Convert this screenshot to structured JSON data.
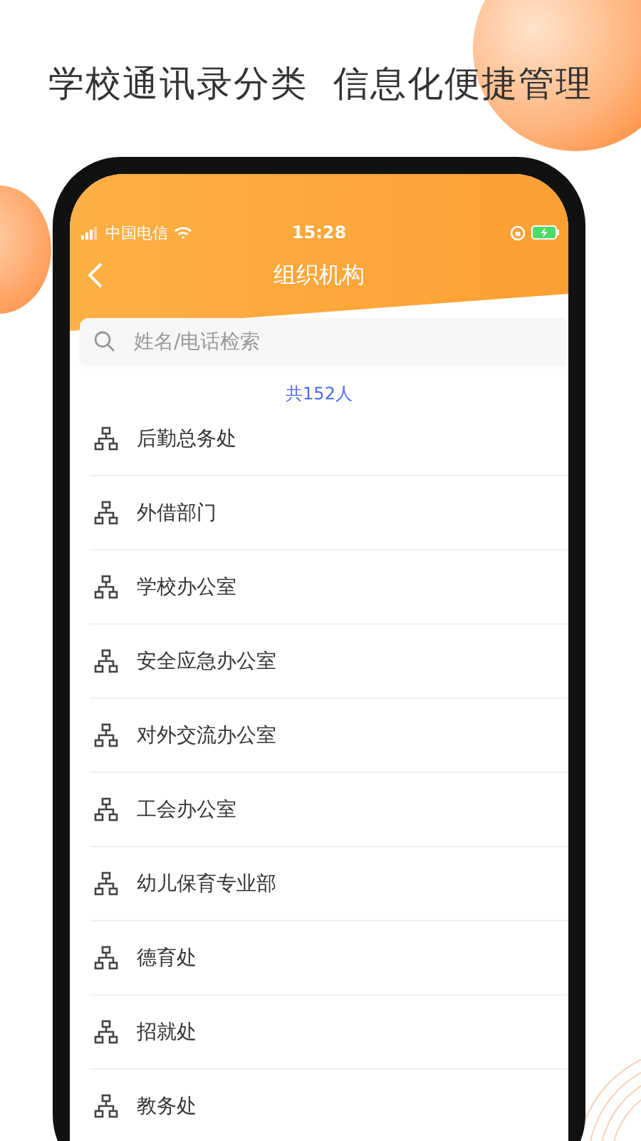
{
  "headline": "学校通讯录分类  信息化便捷管理",
  "status_bar": {
    "carrier": "中国电信",
    "time": "15:28"
  },
  "nav": {
    "title": "组织机构"
  },
  "search": {
    "placeholder": "姓名/电话检索"
  },
  "count": "共152人",
  "departments": [
    {
      "name": "后勤总务处"
    },
    {
      "name": "外借部门"
    },
    {
      "name": "学校办公室"
    },
    {
      "name": "安全应急办公室"
    },
    {
      "name": "对外交流办公室"
    },
    {
      "name": "工会办公室"
    },
    {
      "name": "幼儿保育专业部"
    },
    {
      "name": "德育处"
    },
    {
      "name": "招就处"
    },
    {
      "name": "教务处"
    }
  ]
}
